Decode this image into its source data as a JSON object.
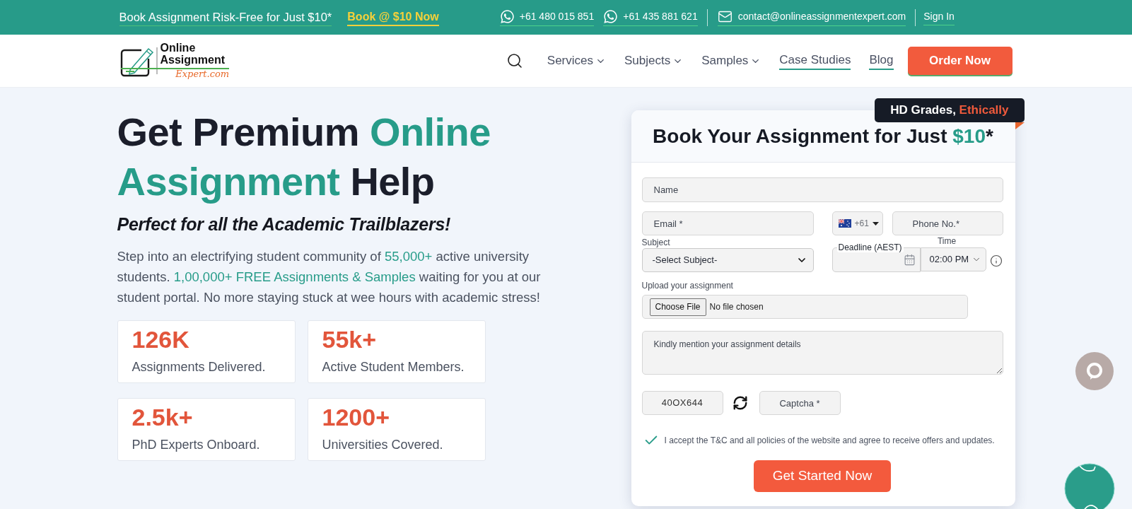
{
  "top_bar": {
    "promo": "Book Assignment Risk-Free for Just $10*",
    "promo_link": "Book @ $10 Now",
    "phones": [
      "+61 480 015 851",
      "+61 435 881 621"
    ],
    "email": "contact@onlineassignmentexpert.com",
    "sign_in": "Sign In"
  },
  "header": {
    "logo": {
      "name_lines": [
        "Online",
        "Assignment"
      ],
      "domain": "Expert.com"
    },
    "nav": [
      {
        "label": "Services",
        "kind": "dropdown"
      },
      {
        "label": "Subjects",
        "kind": "dropdown"
      },
      {
        "label": "Samples",
        "kind": "dropdown"
      },
      {
        "label": "Case Studies",
        "kind": "link"
      },
      {
        "label": "Blog",
        "kind": "link"
      }
    ],
    "cta": "Order Now"
  },
  "hero": {
    "title_lines": [
      [
        {
          "text": "Get Premium ",
          "highlight": false
        },
        {
          "text": "Online",
          "highlight": true
        }
      ],
      [
        {
          "text": "Assignment",
          "highlight": true
        },
        {
          "text": " Help",
          "highlight": false
        }
      ]
    ],
    "subtitle": "Perfect for all the Academic Trailblazers!",
    "intro": [
      {
        "text": "Step into an electrifying student community of ",
        "highlight": false
      },
      {
        "text": "55,000+",
        "highlight": true
      },
      {
        "text": " active university students. ",
        "highlight": false
      },
      {
        "text": "1,00,000+ FREE Assignments & Samples",
        "highlight": true
      },
      {
        "text": " waiting for you at our student portal. No more staying stuck at wee hours with academic stress!",
        "highlight": false
      }
    ],
    "stats": [
      {
        "value": "126K",
        "label": "Assignments Delivered."
      },
      {
        "value": "55k+",
        "label": "Active Student Members."
      },
      {
        "value": "2.5k+",
        "label": "PhD Experts Onboard."
      },
      {
        "value": "1200+",
        "label": "Universities Covered."
      }
    ]
  },
  "booking_form": {
    "badge": [
      {
        "text": "HD Grades, ",
        "highlight": false
      },
      {
        "text": "Ethically",
        "highlight": true
      }
    ],
    "title": [
      {
        "text": "Book Your Assignment for Just ",
        "highlight": false
      },
      {
        "text": "$10",
        "highlight": true
      },
      {
        "text": "*",
        "highlight": false
      }
    ],
    "name": {
      "placeholder": "Name"
    },
    "email": {
      "placeholder": "Email *"
    },
    "country_code": {
      "value": "+61"
    },
    "phone": {
      "placeholder": "Phone No.*"
    },
    "subject": {
      "label": "Subject",
      "value": "-Select Subject-"
    },
    "deadline": {
      "label": "Deadline (AEST)"
    },
    "time": {
      "label": "Time",
      "value": "02:00 PM"
    },
    "upload": {
      "label": "Upload your assignment",
      "button": "Choose File",
      "status": "No file chosen"
    },
    "details": {
      "placeholder": "Kindly mention your assignment details"
    },
    "captcha": {
      "code": "40OX644",
      "placeholder": "Captcha *"
    },
    "consent": {
      "checked": true,
      "text": "I accept the T&C and all policies of the website and agree to receive offers and updates."
    },
    "submit": "Get Started Now"
  }
}
